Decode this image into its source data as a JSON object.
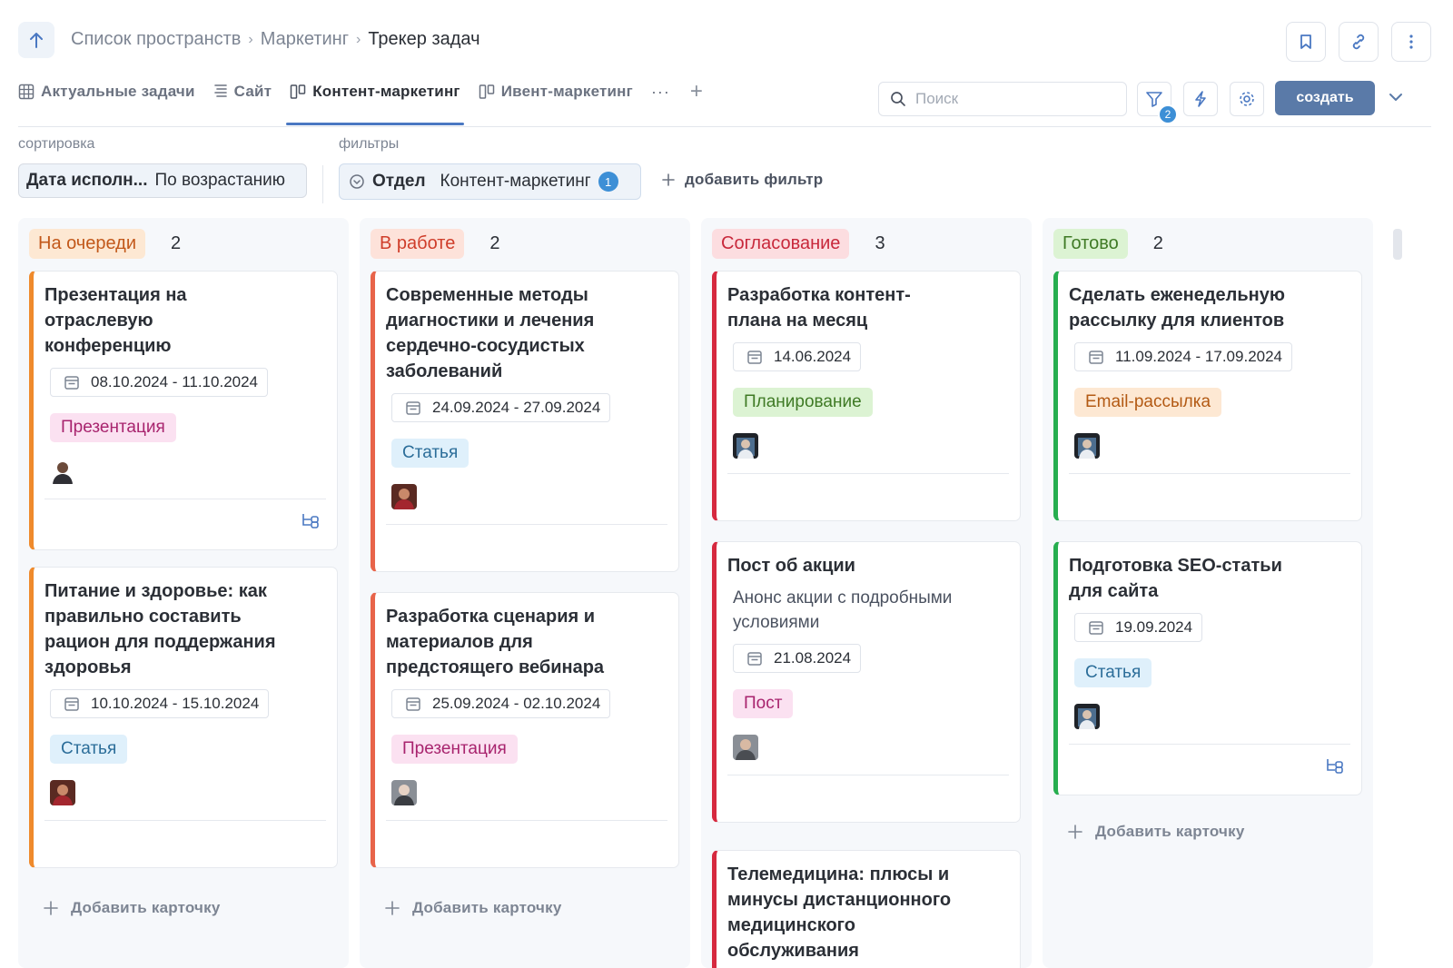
{
  "breadcrumb": [
    "Список пространств",
    "Маркетинг",
    "Трекер задач"
  ],
  "tabs": [
    {
      "label": "Актуальные задачи",
      "icon": "table-icon"
    },
    {
      "label": "Сайт",
      "icon": "list-icon"
    },
    {
      "label": "Контент-маркетинг",
      "icon": "kanban-icon",
      "active": true
    },
    {
      "label": "Ивент-маркетинг",
      "icon": "kanban-icon"
    }
  ],
  "tabs_more": "···",
  "search": {
    "placeholder": "Поиск"
  },
  "filter_count": "2",
  "create_label": "создать",
  "sort": {
    "label": "сортировка",
    "field": "Дата исполн...",
    "order": "По возрастанию"
  },
  "filters": {
    "label": "фильтры",
    "field": "Отдел",
    "value": "Контент-маркетинг",
    "count": "1",
    "add_label": "добавить фильтр"
  },
  "add_card_label": "Добавить карточку",
  "colors": {
    "accent": "#5a7aa8",
    "badge": "#3d8fd6"
  },
  "columns": [
    {
      "status": "На очереди",
      "count": "2",
      "cards": [
        {
          "title": "Презентация на отраслевую конференцию",
          "date": "08.10.2024 - 11.10.2024",
          "tag": "Презентация"
        },
        {
          "title": "Питание и здоровье: как правильно составить рацион для поддержания здоровья",
          "date": "10.10.2024 - 15.10.2024",
          "tag": "Статья"
        }
      ]
    },
    {
      "status": "В работе",
      "count": "2",
      "cards": [
        {
          "title": "Современные методы диагностики и лечения сердечно-сосудистых заболеваний",
          "date": "24.09.2024 - 27.09.2024",
          "tag": "Статья"
        },
        {
          "title": "Разработка сценария и материалов для предстоящего вебинара",
          "date": "25.09.2024 - 02.10.2024",
          "tag": "Презентация"
        }
      ]
    },
    {
      "status": "Согласование",
      "count": "3",
      "cards": [
        {
          "title": "Разработка контент-плана на месяц",
          "date": "14.06.2024",
          "tag": "Планирование"
        },
        {
          "title": "Пост об акции",
          "description": "Анонс акции с подробными условиями",
          "date": "21.08.2024",
          "tag": "Пост"
        },
        {
          "title": "Телемедицина: плюсы и минусы дистанционного медицинского обслуживания"
        }
      ]
    },
    {
      "status": "Готово",
      "count": "2",
      "cards": [
        {
          "title": "Сделать еженедельную рассылку для клиентов",
          "date": "11.09.2024 - 17.09.2024",
          "tag": "Email-рассылка"
        },
        {
          "title": "Подготовка SEO-статьи для сайта",
          "date": "19.09.2024",
          "tag": "Статья"
        }
      ]
    }
  ]
}
